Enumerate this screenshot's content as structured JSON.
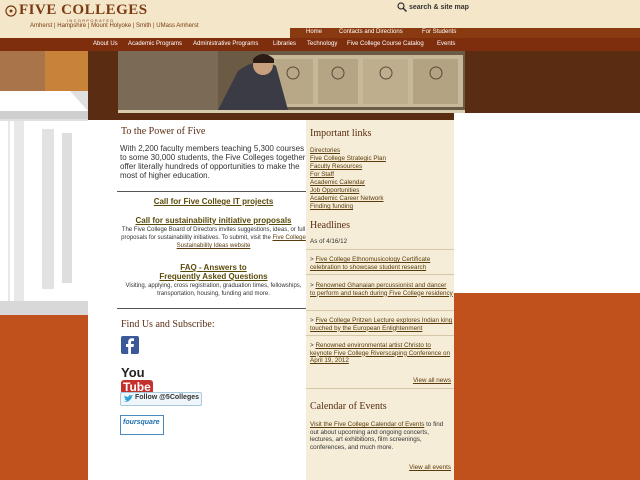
{
  "header": {
    "logo_main": "FIVE COLLEGES",
    "logo_sub": "INCORPORATED",
    "members": "Amherst | Hampshire | Mount Holyoke | Smith | UMass Amherst",
    "search_label": "search & site map"
  },
  "topnav": [
    "Home",
    "Contacts and Directions",
    "For Students"
  ],
  "mainnav": [
    "About Us",
    "Academic Programs",
    "Administrative Programs",
    "Libraries",
    "Technology",
    "Five College Course Catalog",
    "Events"
  ],
  "main": {
    "power_title": "To the Power of Five",
    "power_text": "With 2,200 faculty members teaching 5,300 courses to some 30,000 students, the Five Colleges together offer literally hundreds of opportunities to make the most of higher education.",
    "it_link": "Call for Five College IT projects",
    "sustain_link": "Call for sustainability initiative proposals",
    "sustain_text": "The Five College Board of Directors invites suggestions, ideas, or full proposals for sustainability initiatives. To submit, visit the",
    "sustain_site": "Five College Sustainability Ideas website",
    "faq_link_1": "FAQ - Answers to",
    "faq_link_2": "Frequently Asked Questions",
    "faq_text": "Visiting, applying, cross registration, graduation times, fellowships, transportation, housing, funding and more.",
    "find_title": "Find Us and Subscribe:",
    "twitter_label": "Follow @5Colleges",
    "youtube_label": "YouTube",
    "foursquare_label": "foursquare"
  },
  "side": {
    "important_title": "Important links",
    "links": [
      "Directories",
      "Five College Strategic Plan",
      "Faculty Resources",
      "For Staff",
      "Academic Calendar",
      "Job Opportunities",
      "Academic Career Network",
      "Finding funding"
    ],
    "headlines_title": "Headlines",
    "as_of": "As of 4/16/12",
    "news": [
      "Five College Ethnomusicology Certificate celebration to showcase student research",
      "Renowned Ghanaian percussionist and dancer to perform and teach during Five College residency",
      "Five College Pritzen Lecture explores Indian king touched by the European Enlightenment",
      "Renowned environmental artist Christo to keynote Five College Riverscaping Conference on April 19, 2012"
    ],
    "view_all_news": "View all news",
    "calendar_title": "Calendar of Events",
    "calendar_link": "Visit the Five College Calendar of Events",
    "calendar_text": " to find out about upcoming and ongoing concerts, lectures, art exhibitions, film screenings, conferences, and much more.",
    "view_all_events": "View all events"
  }
}
